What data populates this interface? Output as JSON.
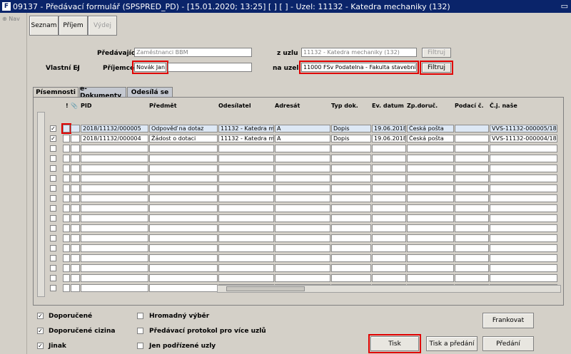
{
  "window": {
    "title": "09137 - Předávací formulář (SPSPRED_PD) - [15.01.2020; 13:25]  [ ]  [ ] - Uzel: 11132 - Katedra mechaniky (132)",
    "app_icon": "F",
    "restore_glyph": "▭"
  },
  "left": {
    "nav": "Nav"
  },
  "toolbar": {
    "seznam": "Seznam",
    "prijem": "Příjem",
    "vydej": "Výdej"
  },
  "form": {
    "predavajici_label": "Předávající",
    "predavajici_value": "Zaměstnanci BBM",
    "vlastni_ej_label": "Vlastní EJ",
    "vlastni_ej_checked": "✓",
    "prijemce_label": "Příjemce",
    "prijemce_value": "Novák Jan",
    "z_uzlu_label": "z uzlu",
    "z_uzlu_value": "11132 - Katedra mechaniky (132)",
    "na_uzel_label": "na uzel",
    "na_uzel_value": "11000 FSv Podatelna - Fakulta stavební (100",
    "filtruj1": "Filtruj",
    "filtruj2": "Filtruj"
  },
  "tabs": {
    "pisemnosti": "Písemnosti",
    "edokumenty": "e-Dokumenty",
    "odesila_se": "Odesílá se"
  },
  "grid": {
    "headers": {
      "excl": "!",
      "clip": "📎",
      "pid": "PID",
      "predmet": "Předmět",
      "odesilatel": "Odesílatel",
      "adresat": "Adresát",
      "typ": "Typ dok.",
      "ev": "Ev. datum",
      "zp": "Zp.doruč.",
      "podaci": "Podací č.",
      "cj": "Č.j. naše"
    },
    "rows": [
      {
        "check": "✓",
        "pid": "2018/11132/000005",
        "predmet": "Odpověď na dotaz",
        "odesilatel": "11132 - Katedra mec",
        "adresat": "A",
        "typ": "Dopis",
        "ev": "19.06.2018",
        "zp": "Česká pošta",
        "podaci": "",
        "cj": "VVS-11132-000005/18"
      },
      {
        "check": "✓",
        "pid": "2018/11132/000004",
        "predmet": "Žádost o dotaci",
        "odesilatel": "11132 - Katedra mec",
        "adresat": "A",
        "typ": "Dopis",
        "ev": "19.06.2018",
        "zp": "Česká pošta",
        "podaci": "",
        "cj": "VVS-11132-000004/18"
      }
    ]
  },
  "options": {
    "doporucene": "Doporučené",
    "doporucene_cizina": "Doporučené cizina",
    "jinak": "Jinak",
    "hromadny": "Hromadný výběr",
    "protokol": "Předávací protokol pro více uzlů",
    "podrizene": "Jen podřízené uzly",
    "checked": "✓"
  },
  "buttons": {
    "frankovat": "Frankovat",
    "tisk": "Tisk",
    "tisk_predani": "Tisk a předání",
    "predani": "Předání"
  }
}
